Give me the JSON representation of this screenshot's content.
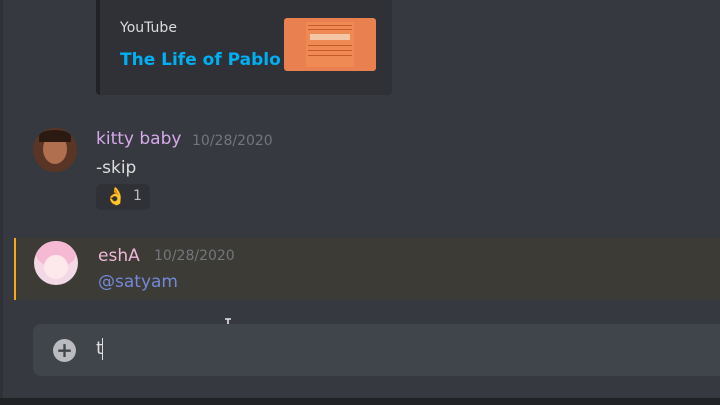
{
  "embed": {
    "provider": "YouTube",
    "title": "The Life of Pablo"
  },
  "messages": [
    {
      "username": "kitty baby",
      "timestamp": "10/28/2020",
      "content": "-skip",
      "reaction": {
        "emoji": "👌",
        "count": "1"
      }
    },
    {
      "username": "eshA",
      "timestamp": "10/28/2020",
      "mention": "@satyam"
    }
  ],
  "chat_input": {
    "value": "t"
  },
  "colors": {
    "background": "#36393f",
    "link": "#00b0f4",
    "mention": "#7289da",
    "highlight_border": "#faa81a"
  }
}
